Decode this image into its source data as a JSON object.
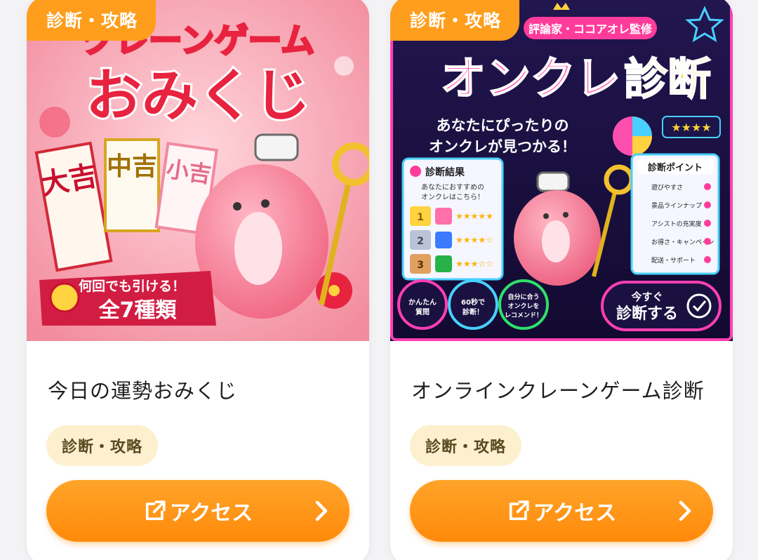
{
  "cards": [
    {
      "tag": "診断・攻略",
      "title": "今日の運勢おみくじ",
      "chip": "診断・攻略",
      "button": "アクセス",
      "banner": {
        "headline_top": "クレーンゲーム",
        "headline_main": "おみくじ",
        "slips": [
          "大吉",
          "中吉",
          "小吉"
        ],
        "ribbon_line1": "何回でも引ける！",
        "ribbon_line2": "全7種類"
      }
    },
    {
      "tag": "診断・攻略",
      "title": "オンラインクレーンゲーム診断",
      "chip": "診断・攻略",
      "button": "アクセス",
      "banner": {
        "supervisor": "評論家・ココアオレ監修",
        "headline_a": "オンクレ",
        "headline_b": "診断",
        "subline1": "あなたにぴったりの",
        "subline2": "オンクレが見つかる！",
        "result_title": "診断結果",
        "result_sub1": "あなたにおすすめの",
        "result_sub2": "オンクレはこちら！",
        "ranks": [
          "1",
          "2",
          "3"
        ],
        "points_title": "診断ポイント",
        "points": [
          "遊びやすさ",
          "景品ラインナップ",
          "アシストの充実度",
          "お得さ・キャンペーン",
          "配送・サポート"
        ],
        "badges": [
          {
            "l1": "かんたん",
            "l2": "質問"
          },
          {
            "l1": "60秒で",
            "l2": "診断！"
          },
          {
            "l1": "自分に合う",
            "l2": "オンクレを",
            "l3": "レコメンド！"
          }
        ],
        "cta_line1": "今すぐ",
        "cta_line2": "診断する"
      }
    }
  ],
  "colors": {
    "accent_orange": "#ff8a0a",
    "chip_bg": "#fdf0cf",
    "omikuji_bg": "#f7a8b4",
    "neon_bg": "#1a1140"
  },
  "icons": [
    "external-link-icon",
    "chevron-right-icon",
    "star-icon",
    "crown-icon",
    "check-icon"
  ]
}
